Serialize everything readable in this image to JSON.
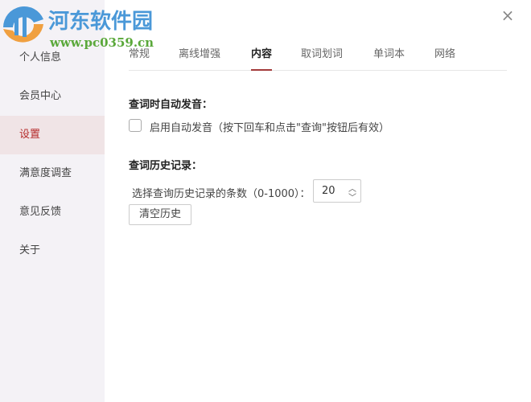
{
  "watermark": {
    "title": "河东软件园",
    "url": "www.pc0359.cn"
  },
  "sidebar": {
    "items": [
      {
        "label": "个人信息"
      },
      {
        "label": "会员中心"
      },
      {
        "label": "设置"
      },
      {
        "label": "满意度调查"
      },
      {
        "label": "意见反馈"
      },
      {
        "label": "关于"
      }
    ],
    "active": "设置"
  },
  "tabs": [
    {
      "label": "常规"
    },
    {
      "label": "离线增强"
    },
    {
      "label": "内容"
    },
    {
      "label": "取词划词"
    },
    {
      "label": "单词本"
    },
    {
      "label": "网络"
    }
  ],
  "active_tab": "内容",
  "close_icon": "×",
  "sections": {
    "auto_pronounce": {
      "heading": "查词时自动发音：",
      "checkbox_label": "启用自动发音（按下回车和点击\"查询\"按钮后有效）",
      "checked": false
    },
    "history": {
      "heading": "查词历史记录：",
      "count_label": "选择查询历史记录的条数（0-1000）：",
      "count_value": "20",
      "clear_button": "清空历史"
    }
  },
  "colors": {
    "accent": "#b52a2a",
    "sidebar_bg": "#f4f2f6"
  }
}
